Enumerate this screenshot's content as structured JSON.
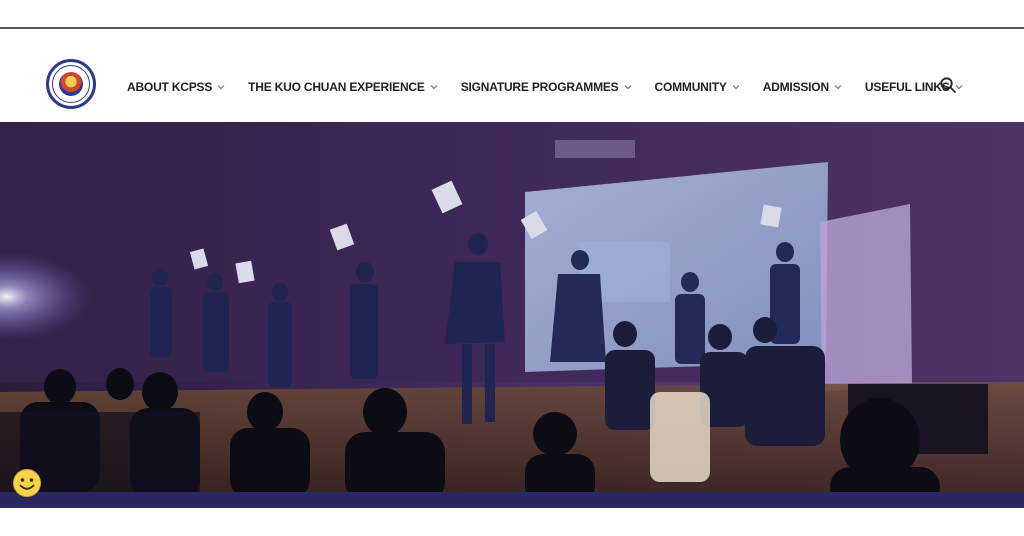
{
  "site": {
    "name": "KCPSS"
  },
  "nav": {
    "items": [
      {
        "label": "ABOUT KCPSS"
      },
      {
        "label": "THE KUO CHUAN EXPERIENCE"
      },
      {
        "label": "SIGNATURE PROGRAMMES"
      },
      {
        "label": "COMMUNITY"
      },
      {
        "label": "ADMISSION"
      },
      {
        "label": "USEFUL LINKS"
      }
    ]
  },
  "icons": {
    "search": "search-icon",
    "dropdown": "chevron-down-icon",
    "feedback": "smiley-icon"
  },
  "colors": {
    "nav_text": "#222222",
    "brand_navy": "#2b2860",
    "hero_purple": "#4a2f6a"
  }
}
